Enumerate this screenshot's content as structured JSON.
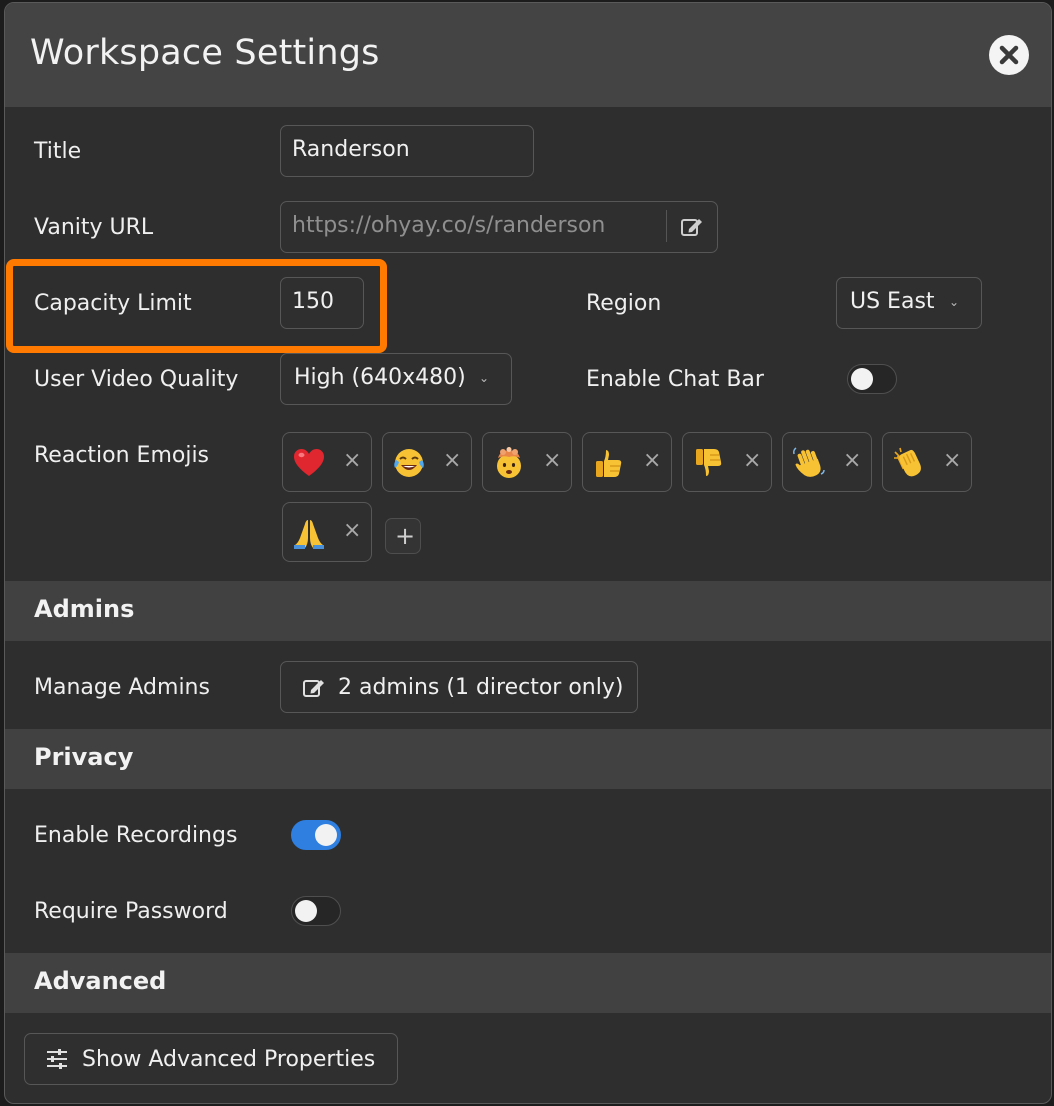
{
  "dialog": {
    "title": "Workspace Settings"
  },
  "fields": {
    "title": {
      "label": "Title",
      "value": "Randerson"
    },
    "vanity_url": {
      "label": "Vanity URL",
      "value": "https://ohyay.co/s/randerson"
    },
    "capacity_limit": {
      "label": "Capacity Limit",
      "value": "150",
      "highlighted": true,
      "highlight_color": "#ff7a00"
    },
    "region": {
      "label": "Region",
      "value": "US East"
    },
    "user_video_quality": {
      "label": "User Video Quality",
      "value": "High (640x480)"
    },
    "enable_chat_bar": {
      "label": "Enable Chat Bar",
      "on": false
    },
    "reaction_emojis": {
      "label": "Reaction Emojis",
      "emojis": [
        "red-heart",
        "face-with-tears-of-joy",
        "exploding-head",
        "thumbs-up",
        "thumbs-down",
        "waving-hand",
        "clapping-hands",
        "folded-hands"
      ],
      "remove_glyph": "×",
      "add_glyph": "+"
    }
  },
  "sections": {
    "admins": {
      "title": "Admins",
      "manage_label": "Manage Admins",
      "manage_button": "2 admins (1 director only)"
    },
    "privacy": {
      "title": "Privacy",
      "enable_recordings": {
        "label": "Enable Recordings",
        "on": true
      },
      "require_password": {
        "label": "Require Password",
        "on": false
      }
    },
    "advanced": {
      "title": "Advanced",
      "show_button": "Show Advanced Properties"
    }
  },
  "colors": {
    "accent_toggle": "#2f7fe0",
    "highlight": "#ff7a00",
    "background": "#2e2e2e",
    "section_bar": "#414141"
  }
}
